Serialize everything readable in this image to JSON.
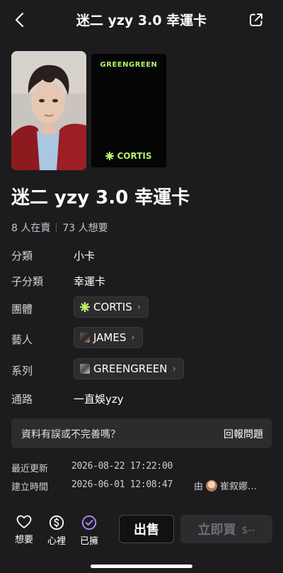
{
  "header": {
    "title": "迷二 yzy 3.0 幸運卡"
  },
  "images": {
    "card_back": {
      "top_text": "GREENGREEN",
      "bottom_text": "CORTIS"
    }
  },
  "product": {
    "title": "迷二 yzy 3.0 幸運卡",
    "selling": "8 人在賣",
    "wanting": "73 人想要"
  },
  "details": {
    "category_label": "分類",
    "category_value": "小卡",
    "subcategory_label": "子分類",
    "subcategory_value": "幸運卡",
    "group_label": "團體",
    "group_value": "CORTIS",
    "artist_label": "藝人",
    "artist_value": "JAMES",
    "series_label": "系列",
    "series_value": "GREENGREEN",
    "channel_label": "通路",
    "channel_value": "一直娛yzy"
  },
  "report": {
    "question": "資料有誤或不完善嗎？",
    "action": "回報問題"
  },
  "meta": {
    "updated_label": "最近更新",
    "updated_value": "2026-08-22 17:22:00",
    "created_label": "建立時間",
    "created_value": "2026-06-01 12:08:47",
    "creator_prefix": "由",
    "creator_name": "崔叙娜…"
  },
  "actions": {
    "want_label": "想要",
    "mind_label": "心裡",
    "owned_label": "已擁",
    "owned_color": "#a98bff",
    "sell_label": "出售",
    "buy_label": "立即買",
    "buy_price": "$--"
  }
}
